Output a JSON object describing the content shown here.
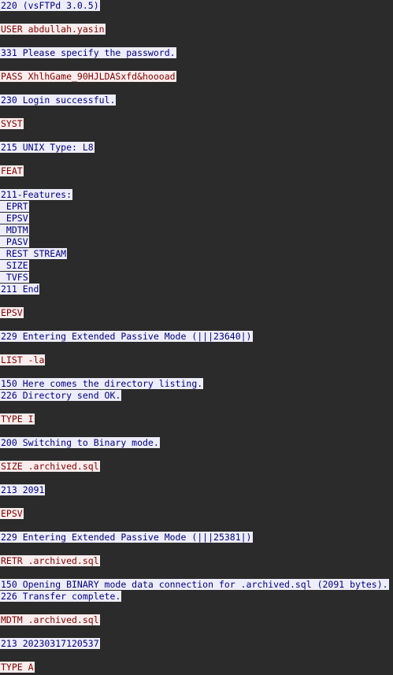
{
  "colors": {
    "background": "#2b2b2b",
    "client_bg": "#fbeded",
    "client_fg": "#7f0000",
    "server_bg": "#ededfb",
    "server_fg": "#00007f"
  },
  "conversation": [
    {
      "dir": "server",
      "text": "220 (vsFTPd 3.0.5)"
    },
    {
      "dir": "spacer",
      "text": ""
    },
    {
      "dir": "client",
      "text": "USER abdullah.yasin"
    },
    {
      "dir": "spacer",
      "text": ""
    },
    {
      "dir": "server",
      "text": "331 Please specify the password."
    },
    {
      "dir": "spacer",
      "text": ""
    },
    {
      "dir": "client",
      "text": "PASS XhlhGame_90HJLDASxfd&hoooad"
    },
    {
      "dir": "spacer",
      "text": ""
    },
    {
      "dir": "server",
      "text": "230 Login successful."
    },
    {
      "dir": "spacer",
      "text": ""
    },
    {
      "dir": "client",
      "text": "SYST"
    },
    {
      "dir": "spacer",
      "text": ""
    },
    {
      "dir": "server",
      "text": "215 UNIX Type: L8"
    },
    {
      "dir": "spacer",
      "text": ""
    },
    {
      "dir": "client",
      "text": "FEAT"
    },
    {
      "dir": "spacer",
      "text": ""
    },
    {
      "dir": "server",
      "text": "211-Features:"
    },
    {
      "dir": "server",
      "text": " EPRT"
    },
    {
      "dir": "server",
      "text": " EPSV"
    },
    {
      "dir": "server",
      "text": " MDTM"
    },
    {
      "dir": "server",
      "text": " PASV"
    },
    {
      "dir": "server",
      "text": " REST STREAM"
    },
    {
      "dir": "server",
      "text": " SIZE"
    },
    {
      "dir": "server",
      "text": " TVFS"
    },
    {
      "dir": "server",
      "text": "211 End"
    },
    {
      "dir": "spacer",
      "text": ""
    },
    {
      "dir": "client",
      "text": "EPSV"
    },
    {
      "dir": "spacer",
      "text": ""
    },
    {
      "dir": "server",
      "text": "229 Entering Extended Passive Mode (|||23640|)"
    },
    {
      "dir": "spacer",
      "text": ""
    },
    {
      "dir": "client",
      "text": "LIST -la"
    },
    {
      "dir": "spacer",
      "text": ""
    },
    {
      "dir": "server",
      "text": "150 Here comes the directory listing."
    },
    {
      "dir": "server",
      "text": "226 Directory send OK."
    },
    {
      "dir": "spacer",
      "text": ""
    },
    {
      "dir": "client",
      "text": "TYPE I"
    },
    {
      "dir": "spacer",
      "text": ""
    },
    {
      "dir": "server",
      "text": "200 Switching to Binary mode."
    },
    {
      "dir": "spacer",
      "text": ""
    },
    {
      "dir": "client",
      "text": "SIZE .archived.sql"
    },
    {
      "dir": "spacer",
      "text": ""
    },
    {
      "dir": "server",
      "text": "213 2091"
    },
    {
      "dir": "spacer",
      "text": ""
    },
    {
      "dir": "client",
      "text": "EPSV"
    },
    {
      "dir": "spacer",
      "text": ""
    },
    {
      "dir": "server",
      "text": "229 Entering Extended Passive Mode (|||25381|)"
    },
    {
      "dir": "spacer",
      "text": ""
    },
    {
      "dir": "client",
      "text": "RETR .archived.sql"
    },
    {
      "dir": "spacer",
      "text": ""
    },
    {
      "dir": "server",
      "text": "150 Opening BINARY mode data connection for .archived.sql (2091 bytes)."
    },
    {
      "dir": "server",
      "text": "226 Transfer complete."
    },
    {
      "dir": "spacer",
      "text": ""
    },
    {
      "dir": "client",
      "text": "MDTM .archived.sql"
    },
    {
      "dir": "spacer",
      "text": ""
    },
    {
      "dir": "server",
      "text": "213 20230317120537"
    },
    {
      "dir": "spacer",
      "text": ""
    },
    {
      "dir": "client",
      "text": "TYPE A"
    }
  ]
}
